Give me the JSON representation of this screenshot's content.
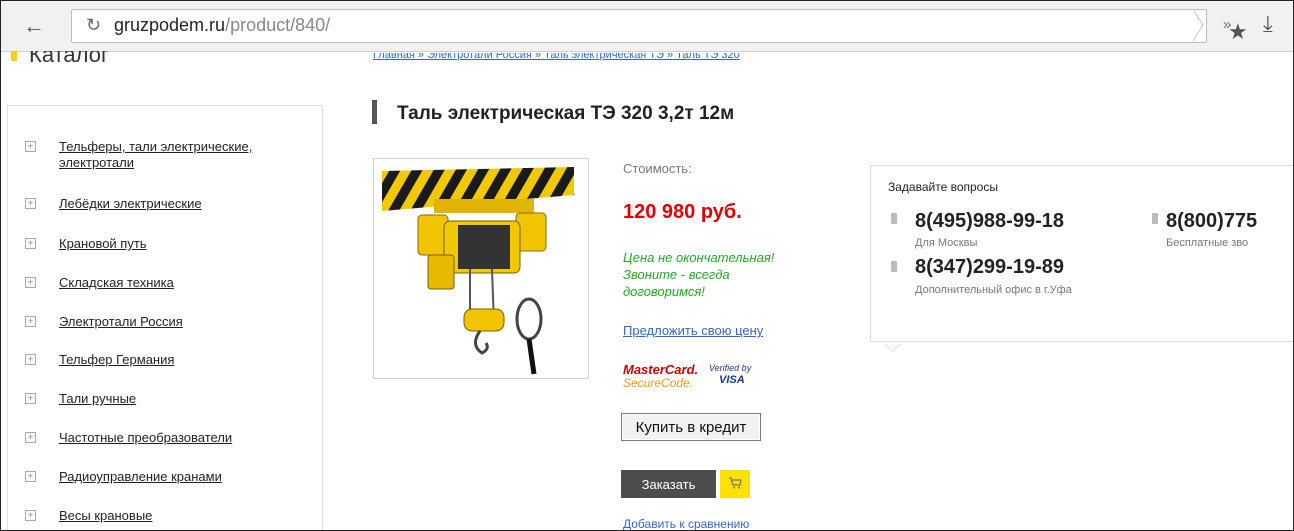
{
  "browser": {
    "url_domain": "gruzpodem.ru",
    "url_path": "/product/840/",
    "back_symbol": "←",
    "reload_symbol": "↻",
    "star_symbol": "★",
    "more_symbol": "»",
    "download_symbol": "⤓"
  },
  "sidebar": {
    "title": "Каталог",
    "items": [
      {
        "label_line1": "Тельферы, тали электрические,",
        "label_line2": "электротали"
      },
      {
        "label_line1": "Лебёдки электрические"
      },
      {
        "label_line1": "Крановой путь"
      },
      {
        "label_line1": "Складская техника"
      },
      {
        "label_line1": "Электротали Россия"
      },
      {
        "label_line1": "Тельфер Германия"
      },
      {
        "label_line1": "Тали ручные"
      },
      {
        "label_line1": "Частотные преобразователи"
      },
      {
        "label_line1": "Радиоуправление кранами"
      },
      {
        "label_line1": "Весы крановые"
      }
    ]
  },
  "breadcrumb": "Главная » Электротали Россия » Таль электрическая ТЭ » Таль ТЭ 320",
  "product": {
    "title": "Таль электрическая ТЭ 320 3,2т 12м",
    "price_label": "Стоимость:",
    "price": "120 980 руб.",
    "note_line1": "Цена не окончательная!",
    "note_line2": "Звоните - всегда",
    "note_line3": "договоримся!",
    "offer_link": "Предложить свою цену",
    "mastercard_line1": "MasterCard.",
    "mastercard_line2": "SecureCode.",
    "visa_line1": "Verified by",
    "visa_line2": "VISA",
    "credit_button": "Купить в кредит",
    "order_button": "Заказать",
    "cart_icon": "cart-icon",
    "compare_link": "Добавить к сравнению"
  },
  "contacts": {
    "heading": "Задавайте вопросы",
    "phones": [
      {
        "number": "8(495)988-99-18",
        "caption": "Для Москвы"
      },
      {
        "number": "8(800)775",
        "caption": "Бесплатные зво"
      },
      {
        "number": "8(347)299-19-89",
        "caption": "Дополнительный офис в г.Уфа"
      }
    ]
  },
  "colors": {
    "price": "#e30000",
    "note": "#22aa22",
    "link": "#3366cc",
    "cart": "#ffe100",
    "order": "#4d4d4d"
  }
}
